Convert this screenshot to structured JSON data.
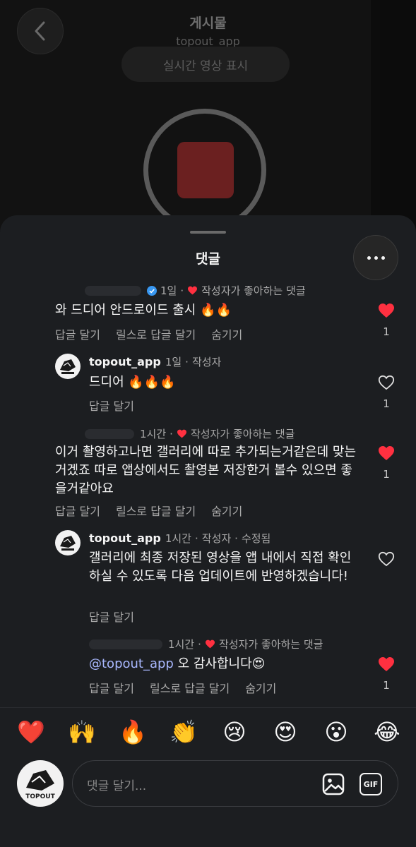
{
  "post_header": {
    "title": "게시물",
    "subtitle": "topout_app",
    "live_button": "실시간 영상 표시"
  },
  "sheet": {
    "title": "댓글"
  },
  "comments": [
    {
      "time": "1일",
      "liked_label": "작성자가 좋아하는 댓글",
      "text": "와 드디어 안드로이드 출시 🔥🔥",
      "reply": "답글 달기",
      "reels_reply": "릴스로 답글 달기",
      "hide": "숨기기",
      "likes": "1",
      "liked": true
    },
    {
      "username": "topout_app",
      "time": "1일",
      "role": "작성자",
      "text": "드디어 🔥🔥🔥",
      "reply": "답글 달기",
      "likes": "1",
      "liked": false
    },
    {
      "time": "1시간",
      "liked_label": "작성자가 좋아하는 댓글",
      "text": "이거 촬영하고나면 갤러리에 따로 추가되는거같은데 맞는거겠죠 따로 앱상에서도 촬영본 저장한거 볼수 있으면 좋을거같아요",
      "reply": "답글 달기",
      "reels_reply": "릴스로 답글 달기",
      "hide": "숨기기",
      "likes": "1",
      "liked": true
    },
    {
      "username": "topout_app",
      "time": "1시간",
      "role": "작성자",
      "edited": "수정됨",
      "text": "갤러리에 최종 저장된 영상을 앱 내에서 직접 확인하실 수 있도록 다음 업데이트에 반영하겠습니다!",
      "reply": "답글 달기",
      "liked": false
    },
    {
      "time": "1시간",
      "liked_label": "작성자가 좋아하는 댓글",
      "mention": "@topout_app",
      "text": " 오 감사합니다😍",
      "reply": "답글 달기",
      "reels_reply": "릴스로 답글 달기",
      "hide": "숨기기",
      "likes": "1",
      "liked": true
    }
  ],
  "quick_emojis": [
    "❤️",
    "🙌",
    "🔥",
    "👏",
    "😢",
    "😍",
    "😮",
    "😂"
  ],
  "composer": {
    "placeholder": "댓글 달기...",
    "gif_label": "GIF",
    "avatar_text": "TOPOUT"
  },
  "colors": {
    "heart_red": "#ff3040",
    "sheet_bg": "#1c1e21",
    "mention": "#a9b8ff",
    "verified_blue": "#3897f0"
  }
}
